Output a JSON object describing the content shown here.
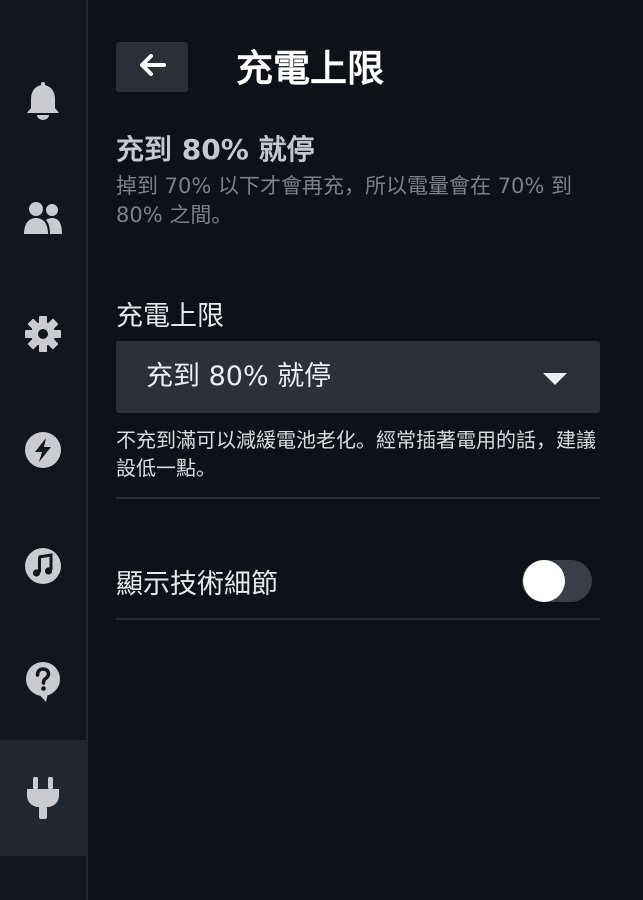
{
  "sidebar": {
    "items": [
      {
        "icon": "bell-icon",
        "active": false
      },
      {
        "icon": "friends-icon",
        "active": false
      },
      {
        "icon": "gear-icon",
        "active": false
      },
      {
        "icon": "lightning-icon",
        "active": false
      },
      {
        "icon": "music-icon",
        "active": false
      },
      {
        "icon": "help-icon",
        "active": false
      },
      {
        "icon": "plug-icon",
        "active": true
      }
    ]
  },
  "header": {
    "back_icon": "arrow-left-icon",
    "title": "充電上限"
  },
  "summary": {
    "title": "充到 80% 就停",
    "description": "掉到 70% 以下才會再充，所以電量會在 70% 到 80% 之間。"
  },
  "charge_limit": {
    "label": "充電上限",
    "selected": "充到 80% 就停",
    "help": "不充到滿可以減緩電池老化。經常插著電用的話，建議設低一點。"
  },
  "technical_details": {
    "label": "顯示技術細節",
    "enabled": false
  },
  "colors": {
    "background": "#0e1218",
    "sidebar": "#12161d",
    "active_item": "#23272f",
    "dropdown": "#2c3038",
    "muted_text": "#7b8089"
  }
}
